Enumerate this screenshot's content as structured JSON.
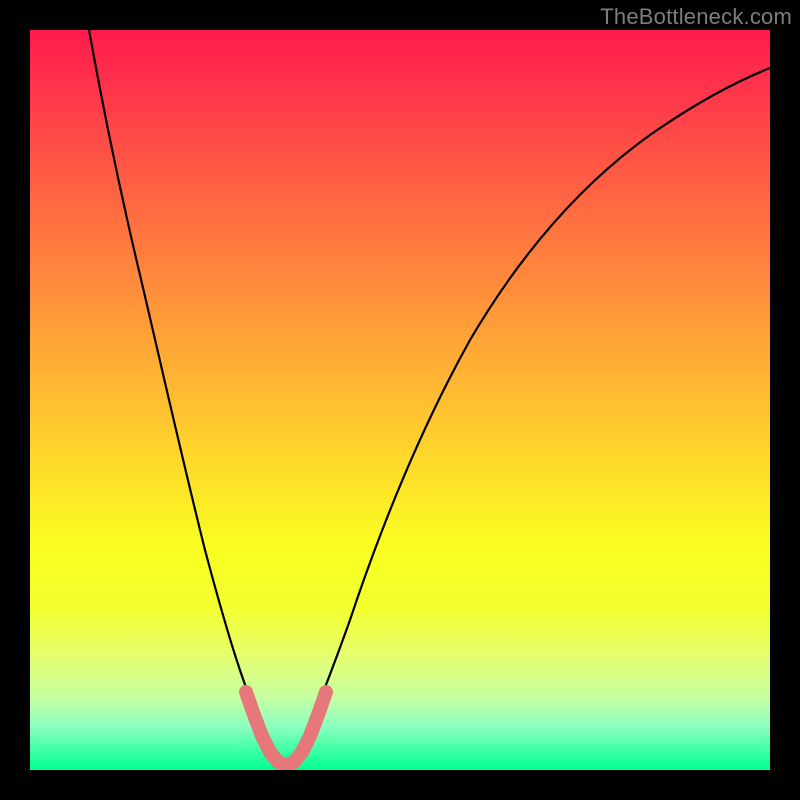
{
  "watermark": {
    "text": "TheBottleneck.com"
  },
  "chart_data": {
    "type": "line",
    "title": "",
    "xlabel": "",
    "ylabel": "",
    "xlim": [
      0,
      100
    ],
    "ylim": [
      0,
      100
    ],
    "grid": false,
    "legend": false,
    "series": [
      {
        "name": "bottleneck-curve",
        "color": "#000000",
        "x": [
          8,
          10,
          12,
          14,
          16,
          18,
          20,
          22,
          24,
          26,
          28,
          30,
          32,
          34,
          36,
          38,
          40,
          44,
          48,
          52,
          56,
          60,
          64,
          68,
          72,
          76,
          80,
          84,
          88,
          92,
          96,
          100
        ],
        "y": [
          100,
          90,
          80,
          71,
          62,
          54,
          46,
          38,
          30,
          22,
          14,
          7,
          2,
          0,
          2,
          7,
          14,
          26,
          36,
          44,
          51,
          57,
          62,
          66,
          70,
          73,
          76,
          78.5,
          80.5,
          82.5,
          84,
          85.5
        ]
      },
      {
        "name": "optimal-band",
        "color": "#e6777b",
        "x": [
          29,
          30,
          31,
          32,
          33,
          34,
          35,
          36,
          37,
          38,
          39
        ],
        "y": [
          10,
          6.5,
          3.5,
          1.5,
          0.5,
          0,
          0.5,
          1.5,
          3.5,
          6.5,
          10
        ]
      }
    ],
    "background_gradient": {
      "direction": "vertical",
      "stops": [
        {
          "pos": 0.0,
          "color": "#ff1a4d"
        },
        {
          "pos": 0.5,
          "color": "#ffcf2f"
        },
        {
          "pos": 0.78,
          "color": "#f3ff2f"
        },
        {
          "pos": 1.0,
          "color": "#00ff8f"
        }
      ]
    }
  }
}
